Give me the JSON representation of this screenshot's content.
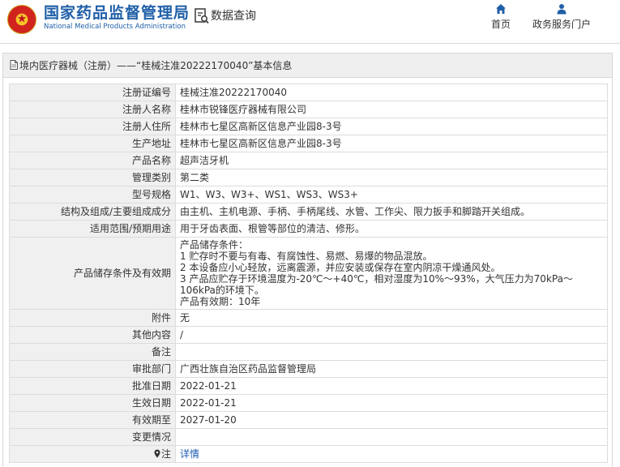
{
  "header": {
    "logo_cn": "国家药品监督管理局",
    "logo_en": "National Medical Products Administration",
    "query_label": "数据查询",
    "nav": [
      {
        "label": "首页",
        "icon": "home-icon"
      },
      {
        "label": "政务服务门户",
        "icon": "user-icon"
      }
    ]
  },
  "panel": {
    "title": "境内医疗器械（注册）——“桂械注准20222170040”基本信息"
  },
  "rows": [
    {
      "label": "注册证编号",
      "value": "桂械注准20222170040"
    },
    {
      "label": "注册人名称",
      "value": "桂林市锐锋医疗器械有限公司"
    },
    {
      "label": "注册人住所",
      "value": "桂林市七星区高新区信息产业园8-3号"
    },
    {
      "label": "生产地址",
      "value": "桂林市七星区高新区信息产业园8-3号"
    },
    {
      "label": "产品名称",
      "value": "超声洁牙机"
    },
    {
      "label": "管理类别",
      "value": "第二类"
    },
    {
      "label": "型号规格",
      "value": "W1、W3、W3+、WS1、WS3、WS3+"
    },
    {
      "label": "结构及组成/主要组成成分",
      "value": "由主机、主机电源、手柄、手柄尾线、水管、工作尖、限力扳手和脚踏开关组成。"
    },
    {
      "label": "适用范围/预期用途",
      "value": "用于牙齿表面、根管等部位的清洁、修形。"
    }
  ],
  "storage": {
    "label": "产品储存条件及有效期",
    "lines": [
      "产品储存条件：",
      "1 贮存时不要与有毒、有腐蚀性、易燃、易爆的物品混放。",
      "2 本设备应小心轻放，远离震源，并应安装或保存在室内阴凉干燥通风处。",
      "3 产品应贮存于环境温度为-20℃～+40℃，相对湿度为10%～93%，大气压力为70kPa～106kPa的环境下。",
      "产品有效期：10年"
    ]
  },
  "rows2": [
    {
      "label": "附件",
      "value": "无"
    },
    {
      "label": "其他内容",
      "value": "/"
    },
    {
      "label": "备注",
      "value": ""
    },
    {
      "label": "审批部门",
      "value": "广西壮族自治区药品监督管理局"
    },
    {
      "label": "批准日期",
      "value": "2022-01-21"
    },
    {
      "label": "生效日期",
      "value": "2022-01-21"
    },
    {
      "label": "有效期至",
      "value": "2027-01-20"
    },
    {
      "label": "变更情况",
      "value": ""
    }
  ],
  "note": {
    "label": "注",
    "link": "详情",
    "icon": "map-pin-icon"
  },
  "colors": {
    "brand_blue": "#1f5fa8",
    "link_blue": "#1a5bb0",
    "label_bg": "#f0f0f0"
  }
}
